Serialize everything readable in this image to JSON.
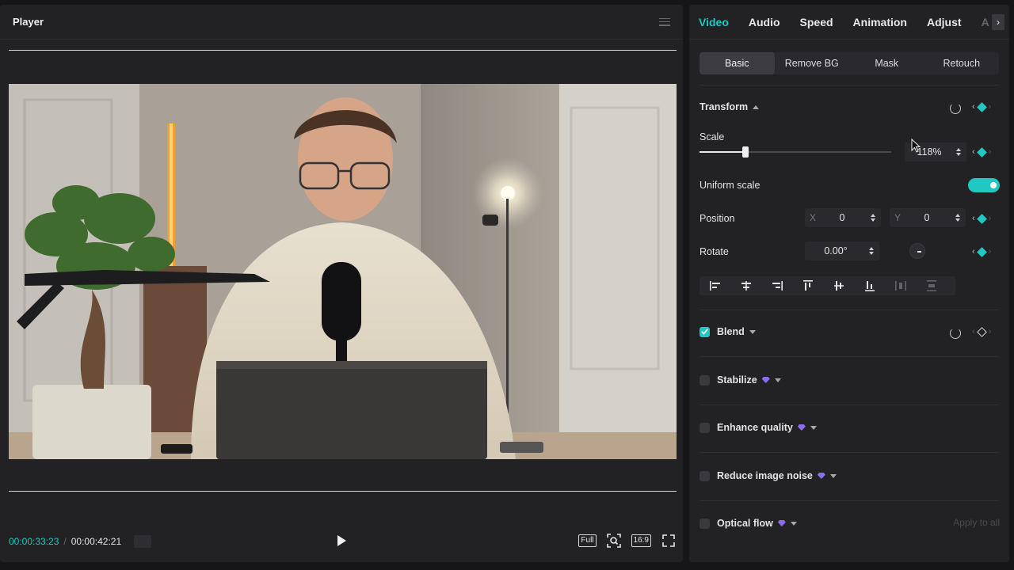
{
  "player": {
    "title": "Player",
    "current_time": "00:00:33:23",
    "total_time": "00:00:42:21",
    "full_label": "Full",
    "ratio_label": "16:9"
  },
  "tabs": [
    {
      "label": "Video",
      "active": true
    },
    {
      "label": "Audio"
    },
    {
      "label": "Speed"
    },
    {
      "label": "Animation"
    },
    {
      "label": "Adjust"
    },
    {
      "label": "A"
    }
  ],
  "subtabs": [
    {
      "label": "Basic",
      "active": true
    },
    {
      "label": "Remove BG"
    },
    {
      "label": "Mask"
    },
    {
      "label": "Retouch"
    }
  ],
  "transform": {
    "title": "Transform",
    "scale_label": "Scale",
    "scale_value": "118%",
    "scale_fraction": 0.24,
    "uniform_label": "Uniform scale",
    "uniform_on": true,
    "position_label": "Position",
    "x_prefix": "X",
    "x_value": "0",
    "y_prefix": "Y",
    "y_value": "0",
    "rotate_label": "Rotate",
    "rotate_value": "0.00°"
  },
  "sections": {
    "blend": "Blend",
    "stabilize": "Stabilize",
    "enhance": "Enhance quality",
    "noise": "Reduce image noise",
    "optical": "Optical flow",
    "apply_all": "Apply to all"
  },
  "colors": {
    "accent": "#1fc8c2",
    "premium": "#8a6cf0"
  }
}
